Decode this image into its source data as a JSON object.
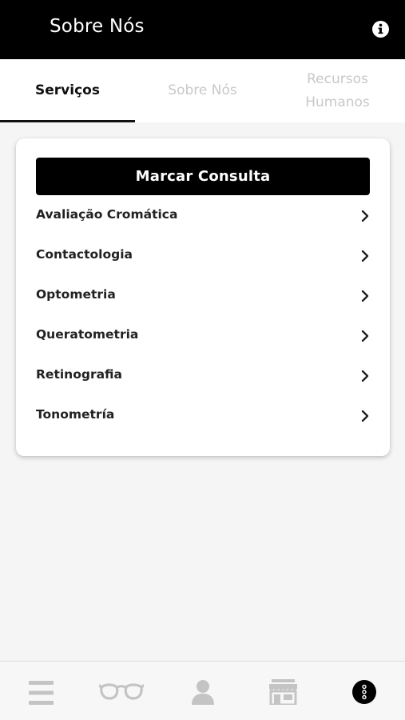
{
  "appbar": {
    "title": "Sobre Nós",
    "info_icon": "info-icon"
  },
  "tabs": [
    {
      "label": "Serviços",
      "active": true
    },
    {
      "label": "Sobre Nós",
      "active": false
    },
    {
      "label": "Recursos Humanos",
      "active": false
    }
  ],
  "card": {
    "cta_label": "Marcar Consulta",
    "items": [
      {
        "label": "Avaliação Cromática"
      },
      {
        "label": "Contactologia"
      },
      {
        "label": "Optometria"
      },
      {
        "label": "Queratometria"
      },
      {
        "label": "Retinografia"
      },
      {
        "label": "Tonometría"
      }
    ]
  },
  "bottom_nav": [
    {
      "icon": "menu-icon",
      "active": false
    },
    {
      "icon": "glasses-icon",
      "active": false
    },
    {
      "icon": "profile-icon",
      "active": false
    },
    {
      "icon": "store-icon",
      "active": false
    },
    {
      "icon": "about-icon",
      "active": true
    }
  ],
  "colors": {
    "appbar_bg": "#000000",
    "active_tab": "#111111",
    "inactive_tab": "#c8c8c8",
    "nav_inactive": "#c4c4c4",
    "nav_active": "#000000"
  }
}
